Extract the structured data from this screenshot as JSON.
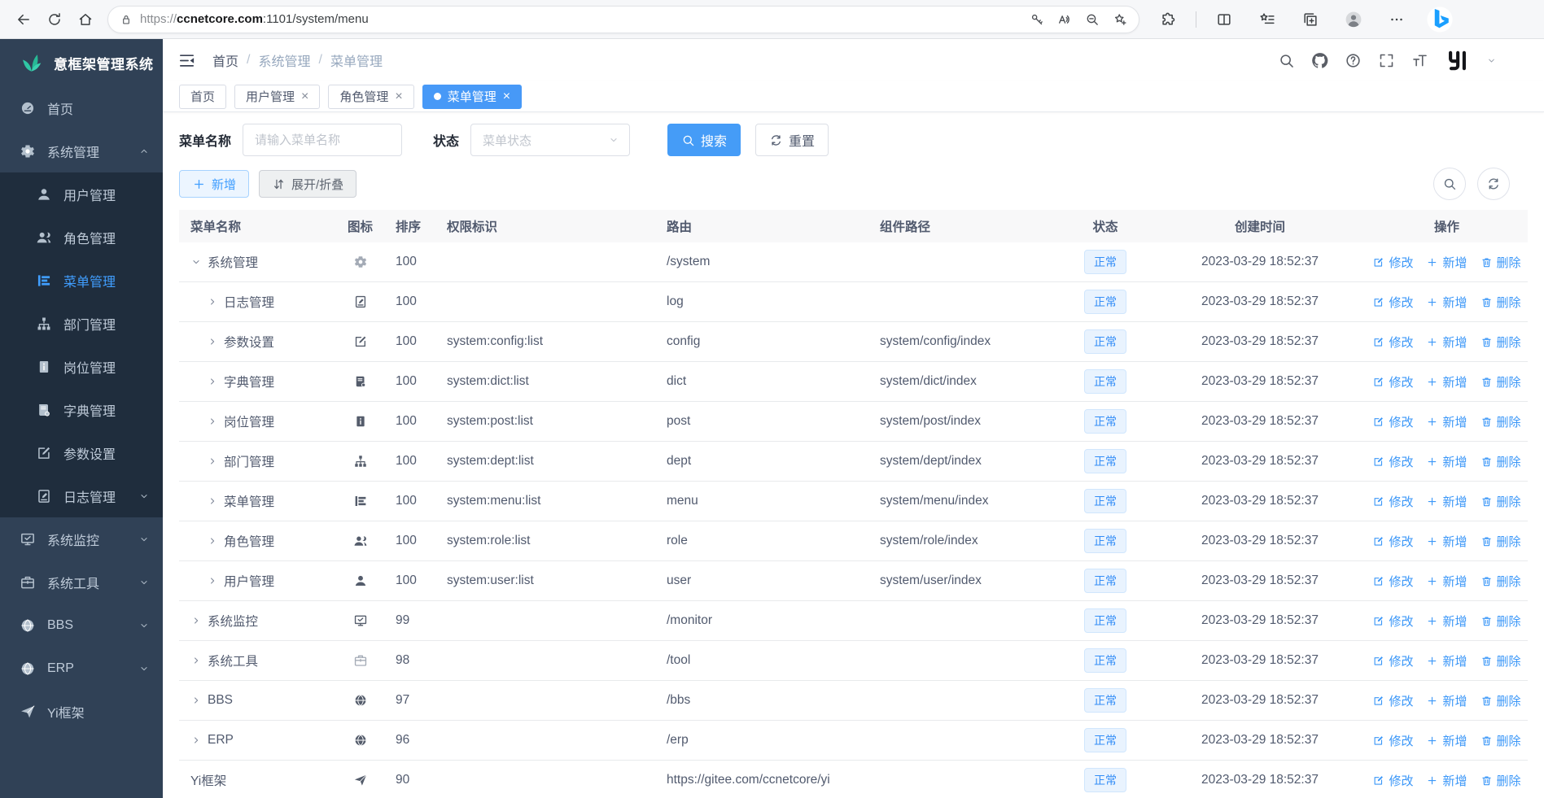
{
  "browser": {
    "url": {
      "scheme": "https://",
      "host": "ccnetcore.com",
      "path": ":1101/system/menu"
    }
  },
  "sidebar": {
    "logo_title": "意框架管理系统",
    "items": [
      {
        "id": "home",
        "label": "首页",
        "icon": "dashboard",
        "level": 0
      },
      {
        "id": "system",
        "label": "系统管理",
        "icon": "gear",
        "level": 0,
        "caret": "up"
      },
      {
        "id": "user",
        "label": "用户管理",
        "icon": "user",
        "level": 1
      },
      {
        "id": "role",
        "label": "角色管理",
        "icon": "users",
        "level": 1
      },
      {
        "id": "menu",
        "label": "菜单管理",
        "icon": "menu",
        "level": 1,
        "active": true
      },
      {
        "id": "dept",
        "label": "部门管理",
        "icon": "tree",
        "level": 1
      },
      {
        "id": "post",
        "label": "岗位管理",
        "icon": "badge",
        "level": 1
      },
      {
        "id": "dict",
        "label": "字典管理",
        "icon": "book",
        "level": 1
      },
      {
        "id": "config",
        "label": "参数设置",
        "icon": "edit",
        "level": 1
      },
      {
        "id": "log",
        "label": "日志管理",
        "icon": "log",
        "level": 1,
        "caret": "down"
      },
      {
        "id": "monitor",
        "label": "系统监控",
        "icon": "monitor",
        "level": 0,
        "caret": "down"
      },
      {
        "id": "tool",
        "label": "系统工具",
        "icon": "tool",
        "level": 0,
        "caret": "down"
      },
      {
        "id": "bbs",
        "label": "BBS",
        "icon": "globe",
        "level": 0,
        "caret": "down"
      },
      {
        "id": "erp",
        "label": "ERP",
        "icon": "globe",
        "level": 0,
        "caret": "down"
      },
      {
        "id": "yi",
        "label": "Yi框架",
        "icon": "plane",
        "level": 0
      }
    ]
  },
  "navbar": {
    "breadcrumb": [
      "首页",
      "系统管理",
      "菜单管理"
    ]
  },
  "tabs": [
    {
      "label": "首页",
      "closable": false,
      "active": false
    },
    {
      "label": "用户管理",
      "closable": true,
      "active": false
    },
    {
      "label": "角色管理",
      "closable": true,
      "active": false
    },
    {
      "label": "菜单管理",
      "closable": true,
      "active": true
    }
  ],
  "filters": {
    "name_label": "菜单名称",
    "name_placeholder": "请输入菜单名称",
    "status_label": "状态",
    "status_placeholder": "菜单状态",
    "search_label": "搜索",
    "reset_label": "重置"
  },
  "toolbar": {
    "add_label": "新增",
    "toggle_label": "展开/折叠"
  },
  "table": {
    "columns": [
      "菜单名称",
      "图标",
      "排序",
      "权限标识",
      "路由",
      "组件路径",
      "状态",
      "创建时间",
      "操作"
    ],
    "action_labels": {
      "edit": "修改",
      "add": "新增",
      "delete": "删除"
    },
    "rows": [
      {
        "name": "系统管理",
        "level": 0,
        "expand": "down",
        "icon": "gear",
        "muted": true,
        "sort": "100",
        "perm": "",
        "route": "/system",
        "component": "",
        "status": "正常",
        "created": "2023-03-29 18:52:37"
      },
      {
        "name": "日志管理",
        "level": 1,
        "expand": "right",
        "icon": "log",
        "muted": false,
        "sort": "100",
        "perm": "",
        "route": "log",
        "component": "",
        "status": "正常",
        "created": "2023-03-29 18:52:37"
      },
      {
        "name": "参数设置",
        "level": 1,
        "expand": "right",
        "icon": "edit",
        "muted": false,
        "sort": "100",
        "perm": "system:config:list",
        "route": "config",
        "component": "system/config/index",
        "status": "正常",
        "created": "2023-03-29 18:52:37"
      },
      {
        "name": "字典管理",
        "level": 1,
        "expand": "right",
        "icon": "book",
        "muted": false,
        "sort": "100",
        "perm": "system:dict:list",
        "route": "dict",
        "component": "system/dict/index",
        "status": "正常",
        "created": "2023-03-29 18:52:37"
      },
      {
        "name": "岗位管理",
        "level": 1,
        "expand": "right",
        "icon": "badge",
        "muted": false,
        "sort": "100",
        "perm": "system:post:list",
        "route": "post",
        "component": "system/post/index",
        "status": "正常",
        "created": "2023-03-29 18:52:37"
      },
      {
        "name": "部门管理",
        "level": 1,
        "expand": "right",
        "icon": "tree",
        "muted": false,
        "sort": "100",
        "perm": "system:dept:list",
        "route": "dept",
        "component": "system/dept/index",
        "status": "正常",
        "created": "2023-03-29 18:52:37"
      },
      {
        "name": "菜单管理",
        "level": 1,
        "expand": "right",
        "icon": "menu",
        "muted": false,
        "sort": "100",
        "perm": "system:menu:list",
        "route": "menu",
        "component": "system/menu/index",
        "status": "正常",
        "created": "2023-03-29 18:52:37"
      },
      {
        "name": "角色管理",
        "level": 1,
        "expand": "right",
        "icon": "users",
        "muted": false,
        "sort": "100",
        "perm": "system:role:list",
        "route": "role",
        "component": "system/role/index",
        "status": "正常",
        "created": "2023-03-29 18:52:37"
      },
      {
        "name": "用户管理",
        "level": 1,
        "expand": "right",
        "icon": "user",
        "muted": false,
        "sort": "100",
        "perm": "system:user:list",
        "route": "user",
        "component": "system/user/index",
        "status": "正常",
        "created": "2023-03-29 18:52:37"
      },
      {
        "name": "系统监控",
        "level": 0,
        "expand": "right",
        "icon": "monitor",
        "muted": false,
        "sort": "99",
        "perm": "",
        "route": "/monitor",
        "component": "",
        "status": "正常",
        "created": "2023-03-29 18:52:37"
      },
      {
        "name": "系统工具",
        "level": 0,
        "expand": "right",
        "icon": "tool",
        "muted": true,
        "sort": "98",
        "perm": "",
        "route": "/tool",
        "component": "",
        "status": "正常",
        "created": "2023-03-29 18:52:37"
      },
      {
        "name": "BBS",
        "level": 0,
        "expand": "right",
        "icon": "globe",
        "muted": false,
        "sort": "97",
        "perm": "",
        "route": "/bbs",
        "component": "",
        "status": "正常",
        "created": "2023-03-29 18:52:37"
      },
      {
        "name": "ERP",
        "level": 0,
        "expand": "right",
        "icon": "globe",
        "muted": false,
        "sort": "96",
        "perm": "",
        "route": "/erp",
        "component": "",
        "status": "正常",
        "created": "2023-03-29 18:52:37"
      },
      {
        "name": "Yi框架",
        "level": 0,
        "expand": "none",
        "icon": "plane",
        "muted": false,
        "sort": "90",
        "perm": "",
        "route": "https://gitee.com/ccnetcore/yi",
        "component": "",
        "status": "正常",
        "created": "2023-03-29 18:52:37"
      }
    ]
  }
}
